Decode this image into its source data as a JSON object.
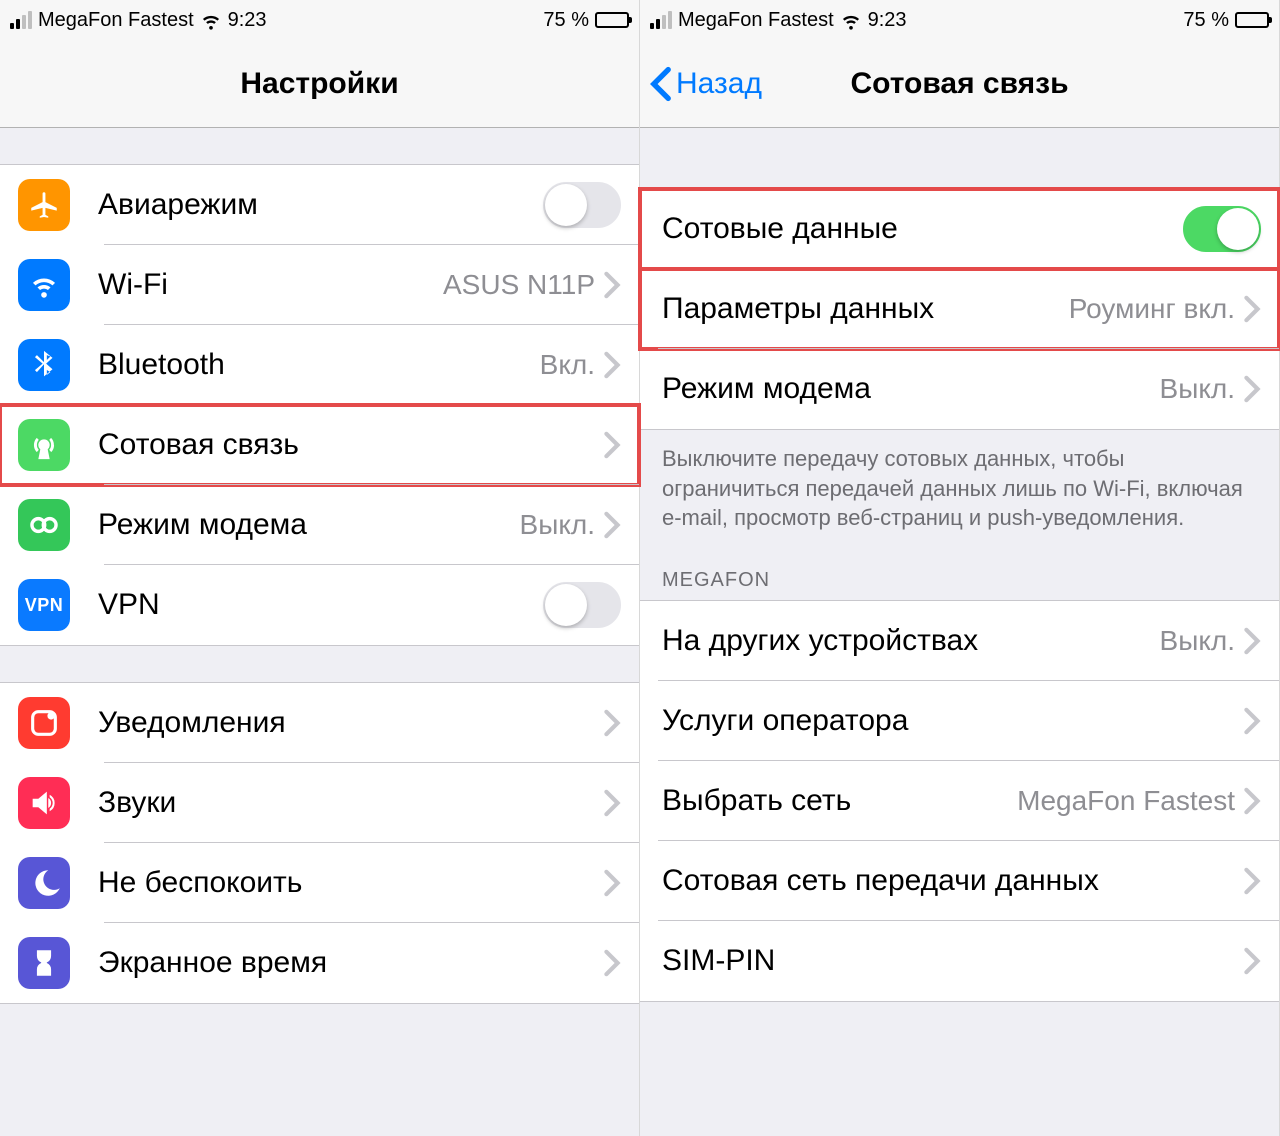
{
  "status": {
    "carrier": "MegaFon Fastest",
    "time": "9:23",
    "battery_pct": "75 %"
  },
  "left": {
    "title": "Настройки",
    "rows": {
      "airplane": {
        "label": "Авиарежим"
      },
      "wifi": {
        "label": "Wi-Fi",
        "value": "ASUS N11P"
      },
      "bluetooth": {
        "label": "Bluetooth",
        "value": "Вкл."
      },
      "cellular": {
        "label": "Сотовая связь"
      },
      "hotspot": {
        "label": "Режим модема",
        "value": "Выкл."
      },
      "vpn": {
        "label": "VPN"
      },
      "notifications": {
        "label": "Уведомления"
      },
      "sounds": {
        "label": "Звуки"
      },
      "dnd": {
        "label": "Не беспокоить"
      },
      "screentime": {
        "label": "Экранное время"
      }
    }
  },
  "right": {
    "back": "Назад",
    "title": "Сотовая связь",
    "rows": {
      "cell_data": {
        "label": "Сотовые данные"
      },
      "data_options": {
        "label": "Параметры данных",
        "value": "Роуминг вкл."
      },
      "hotspot": {
        "label": "Режим модема",
        "value": "Выкл."
      }
    },
    "footer": "Выключите передачу сотовых данных, чтобы ограничиться передачей данных лишь по Wi-Fi, включая e-mail, просмотр веб-страниц и push-уведомления.",
    "carrier_header": "MEGAFON",
    "carrier_rows": {
      "other_devices": {
        "label": "На других устройствах",
        "value": "Выкл."
      },
      "services": {
        "label": "Услуги оператора"
      },
      "select_network": {
        "label": "Выбрать сеть",
        "value": "MegaFon Fastest"
      },
      "apn": {
        "label": "Сотовая сеть передачи данных"
      },
      "sim_pin": {
        "label": "SIM-PIN"
      }
    }
  },
  "icons": {
    "vpn_text": "VPN"
  }
}
